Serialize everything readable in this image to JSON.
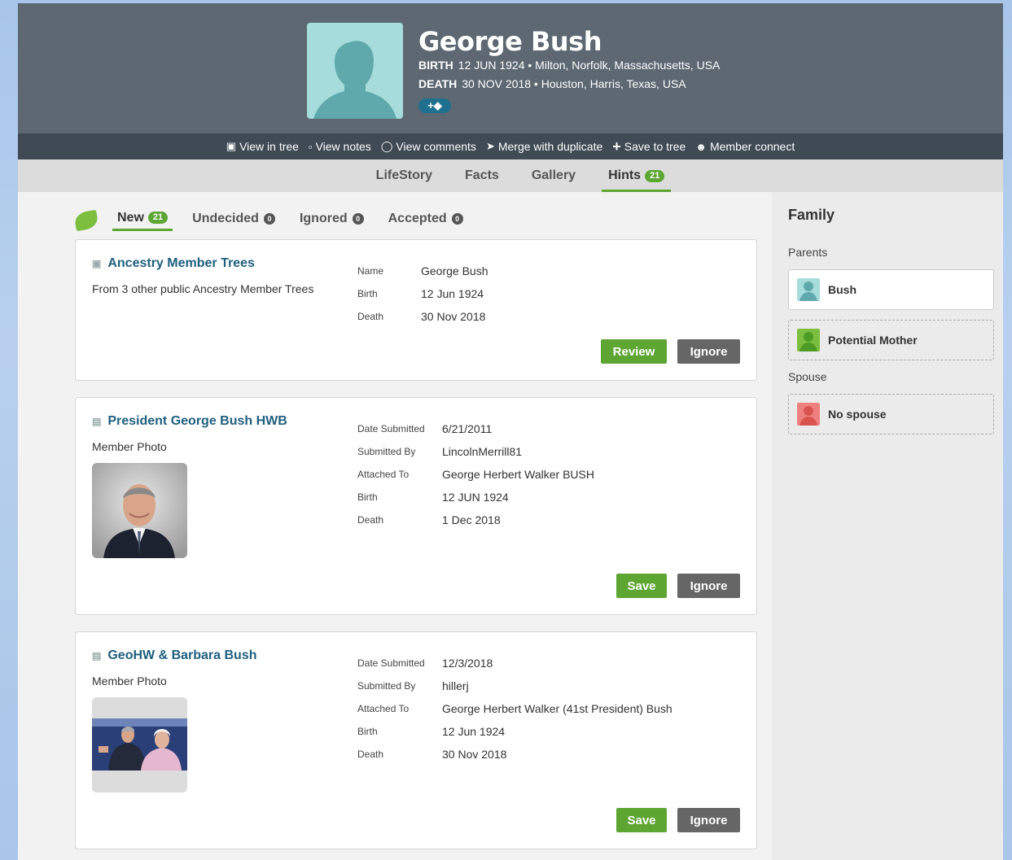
{
  "person": {
    "name": "George Bush",
    "birth_label": "BIRTH",
    "birth_value": "12 JUN 1924 • Milton, Norfolk, Massachusetts, USA",
    "death_label": "DEATH",
    "death_value": "30 NOV 2018 • Houston, Harris, Texas, USA",
    "tag_button": "+◆"
  },
  "toolbar": {
    "view_in_tree": "View in tree",
    "view_notes": "View notes",
    "view_comments": "View comments",
    "merge": "Merge with duplicate",
    "save_to_tree": "Save to tree",
    "member_connect": "Member connect"
  },
  "subnav": {
    "lifestory": "LifeStory",
    "facts": "Facts",
    "gallery": "Gallery",
    "hints": "Hints",
    "hints_count": "21"
  },
  "hint_tabs": {
    "new": "New",
    "new_count": "21",
    "undecided": "Undecided",
    "undecided_count": "0",
    "ignored": "Ignored",
    "ignored_count": "0",
    "accepted": "Accepted",
    "accepted_count": "0"
  },
  "hints": [
    {
      "title": "Ancestry Member Trees",
      "subtitle": "From 3 other public Ancestry Member Trees",
      "facts": [
        {
          "k": "Name",
          "v": "George Bush"
        },
        {
          "k": "Birth",
          "v": "12 Jun 1924"
        },
        {
          "k": "Death",
          "v": "30 Nov 2018"
        }
      ],
      "primary_button": "Review",
      "secondary_button": "Ignore"
    },
    {
      "title": "President George Bush HWB",
      "subtitle": "Member Photo",
      "facts": [
        {
          "k": "Date Submitted",
          "v": "6/21/2011"
        },
        {
          "k": "Submitted By",
          "v": "LincolnMerrill81"
        },
        {
          "k": "Attached To",
          "v": "George Herbert Walker BUSH"
        },
        {
          "k": "Birth",
          "v": "12 JUN 1924"
        },
        {
          "k": "Death",
          "v": "1 Dec 2018"
        }
      ],
      "primary_button": "Save",
      "secondary_button": "Ignore"
    },
    {
      "title": "GeoHW & Barbara Bush",
      "subtitle": "Member Photo",
      "facts": [
        {
          "k": "Date Submitted",
          "v": "12/3/2018"
        },
        {
          "k": "Submitted By",
          "v": "hillerj"
        },
        {
          "k": "Attached To",
          "v": "George Herbert Walker (41st President) Bush"
        },
        {
          "k": "Birth",
          "v": "12 Jun 1924"
        },
        {
          "k": "Death",
          "v": "30 Nov 2018"
        }
      ],
      "primary_button": "Save",
      "secondary_button": "Ignore"
    }
  ],
  "family": {
    "title": "Family",
    "parents_label": "Parents",
    "father": "Bush",
    "mother": "Potential Mother",
    "spouse_label": "Spouse",
    "spouse": "No spouse"
  },
  "colors": {
    "accent_green": "#5da632",
    "link_blue": "#1e5f7e",
    "header_bg": "#5d6872",
    "male_avatar": "#a7dcdc",
    "female_avatar": "#7cbf3f",
    "spouse_avatar": "#f08080"
  }
}
